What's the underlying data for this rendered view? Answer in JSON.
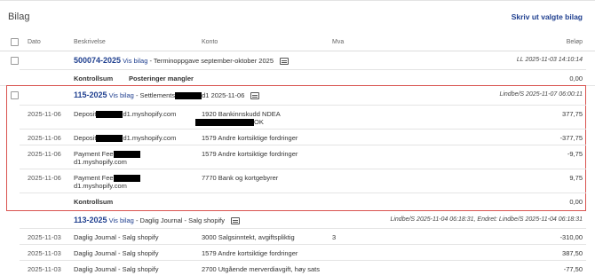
{
  "page": {
    "title": "Bilag",
    "print_link": "Skriv ut valgte bilag"
  },
  "columns": {
    "dato": "Dato",
    "beskrivelse": "Beskrivelse",
    "konto": "Konto",
    "mva": "Mva",
    "belop": "Beløp"
  },
  "vouchers": [
    {
      "id": "500074-2025",
      "vis_label": "Vis bilag",
      "desc": " - Terminoppgave september-oktober 2025",
      "meta": "LL 2025-11-03 14:10:14",
      "summary_label": "Kontrollsum",
      "summary_extra": "Posteringer mangler",
      "summary_value": "0,00"
    },
    {
      "id": "115-2025",
      "vis_label": "Vis bilag",
      "desc_pre": " - Settlements",
      "desc_post": "d1 2025-11-06",
      "meta": "Lindbe/S 2025-11-07 06:00:11",
      "lines": [
        {
          "date": "2025-11-06",
          "desc_pre": "Deposit",
          "desc_post": "d1.myshopify.com",
          "desc_line2": "",
          "account": "1920 Bankinnskudd NDEA",
          "account_line2": "OK",
          "amount": "377,75"
        },
        {
          "date": "2025-11-06",
          "desc_pre": "Deposit",
          "desc_post": "d1.myshopify.com",
          "desc_line2": "",
          "account": "1579 Andre kortsiktige fordringer",
          "account_line2": "",
          "amount": "-377,75"
        },
        {
          "date": "2025-11-06",
          "desc_pre": "Payment Fee",
          "desc_post": "",
          "desc_line2": "d1.myshopify.com",
          "account": "1579 Andre kortsiktige fordringer",
          "account_line2": "",
          "amount": "-9,75"
        },
        {
          "date": "2025-11-06",
          "desc_pre": "Payment Fee",
          "desc_post": "",
          "desc_line2": "d1.myshopify.com",
          "account": "7770 Bank og kortgebyrer",
          "account_line2": "",
          "amount": "9,75"
        }
      ],
      "summary_label": "Kontrollsum",
      "summary_value": "0,00"
    },
    {
      "id": "113-2025",
      "vis_label": "Vis bilag",
      "desc": " - Daglig Journal - Salg shopify",
      "meta": "Lindbe/S 2025-11-04 06:18:31, Endret: Lindbe/S 2025-11-04 06:18:31",
      "lines": [
        {
          "date": "2025-11-03",
          "desc": "Daglig Journal - Salg shopify",
          "account": "3000 Salgsinntekt, avgiftspliktig",
          "mva": "3",
          "amount": "-310,00"
        },
        {
          "date": "2025-11-03",
          "desc": "Daglig Journal - Salg shopify",
          "account": "1579 Andre kortsiktige fordringer",
          "mva": "",
          "amount": "387,50"
        },
        {
          "date": "2025-11-03",
          "desc": "Daglig Journal - Salg shopify",
          "account": "2700 Utgående merverdiavgift, høy sats",
          "mva": "",
          "amount": "-77,50"
        }
      ]
    }
  ]
}
